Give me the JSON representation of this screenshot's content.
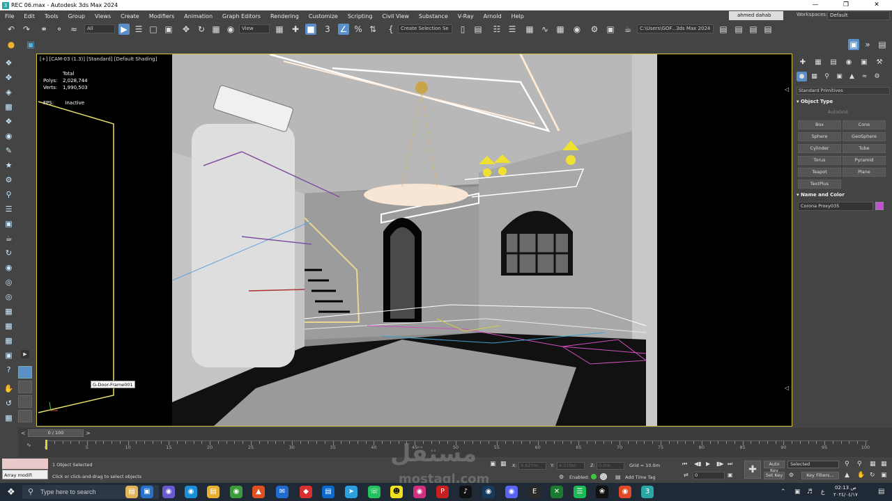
{
  "window": {
    "title": "REC 06.max - Autodesk 3ds Max 2024",
    "app_icon_label": "3"
  },
  "menu": {
    "items": [
      "File",
      "Edit",
      "Tools",
      "Group",
      "Views",
      "Create",
      "Modifiers",
      "Animation",
      "Graph Editors",
      "Rendering",
      "Customize",
      "Scripting",
      "Civil View",
      "Substance",
      "V-Ray",
      "Arnold",
      "Help"
    ],
    "user": "ahmed dahab",
    "workspaces_label": "Workspaces:",
    "workspace": "Default"
  },
  "toolbar": {
    "selection_filter": "All",
    "ref_coord": "View",
    "selection_set": "Create Selection Se",
    "project_path": "C:\\Users\\GOF...3ds Max 2024"
  },
  "viewport": {
    "label": "[+] [CAM-03 (1.3)] [Standard] [Default Shading]",
    "stats_total": "Total",
    "polys_label": "Polys:",
    "polys_value": "2,028,744",
    "verts_label": "Verts:",
    "verts_value": "1,990,503",
    "fps_label": "FPS:",
    "fps_value": "Inactive",
    "tooltip": "G-Door-Frame001"
  },
  "command_panel": {
    "category": "Standard Primitives",
    "object_type_title": "Object Type",
    "autogrid": "AutoGrid",
    "buttons": [
      "Box",
      "Cone",
      "Sphere",
      "GeoSphere",
      "Cylinder",
      "Tube",
      "Torus",
      "Pyramid",
      "Teapot",
      "Plane",
      "TextPlus"
    ],
    "name_color_title": "Name and Color",
    "object_name": "Corona Proxy035",
    "object_color": "#c050d0"
  },
  "timeline": {
    "slider": "0 / 100",
    "ticks": [
      "0",
      "5",
      "10",
      "15",
      "20",
      "25",
      "30",
      "35",
      "40",
      "45",
      "50",
      "55",
      "60",
      "65",
      "70",
      "75",
      "80",
      "85",
      "90",
      "95",
      "100"
    ]
  },
  "status": {
    "maxscript": "Array modifi",
    "selected": "1 Object Selected",
    "prompt": "Click or click-and-drag to select objects",
    "x_label": "X:",
    "x_value": "8.627m",
    "y_label": "Y:",
    "y_value": "4.219m",
    "z_label": "Z:",
    "z_value": "0.0m",
    "grid": "Grid = 10.0m",
    "enabled": "Enabled:",
    "add_time_tag": "Add Time Tag",
    "auto_key": "Auto Key",
    "set_key": "Set Key",
    "key_mode": "Selected",
    "key_filters": "Key Filters...",
    "frame": "0"
  },
  "taskbar": {
    "search_placeholder": "Type here to search",
    "time": "02:13 ص",
    "date": "٢٠٢٤/٠٤/١٧"
  },
  "watermark": {
    "arabic": "مستقل",
    "latin": "mostaql.com"
  }
}
